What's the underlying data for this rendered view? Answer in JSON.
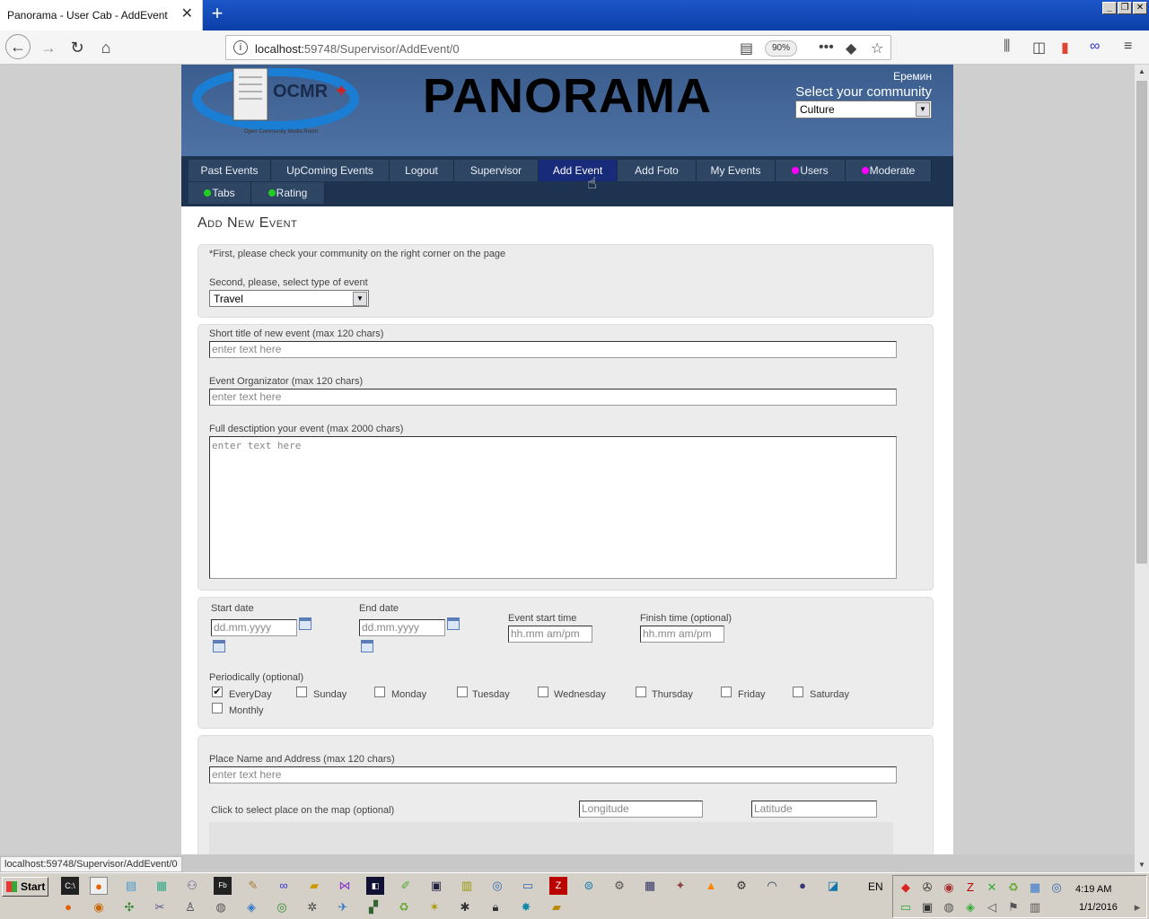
{
  "browser": {
    "tab_title": "Panorama - User Cab - AddEvent",
    "close_tab": "✕",
    "new_tab": "+",
    "url_host": "localhost:",
    "url_path": "59748/Supervisor/AddEvent/0",
    "zoom": "90%",
    "status_url": "localhost:59748/Supervisor/AddEvent/0"
  },
  "header": {
    "logo_text": "OCMR",
    "logo_sub": "Open Community Media Room",
    "brand": "PANORAMA",
    "user": "Еремин",
    "community_label": "Select your community",
    "community_value": "Culture"
  },
  "menu": {
    "past_events": "Past Events",
    "upcoming_events": "UpComing Events",
    "logout": "Logout",
    "supervisor": "Supervisor",
    "add_event": "Add Event",
    "add_foto": "Add Foto",
    "my_events": "My Events",
    "users": "Users",
    "moderate": "Moderate",
    "tabs": "Tabs",
    "rating": "Rating",
    "colors": {
      "magenta": "#ff00ff",
      "green": "#22cc22",
      "active": "#182a7a"
    }
  },
  "form": {
    "page_title": "Add New Event",
    "note_first": "*First, please check your community on the right corner on the page",
    "type_label": "Second, please, select type of event",
    "type_value": "Travel",
    "title_label": "Short title of new event (max 120 chars)",
    "title_placeholder": "enter text here",
    "organizer_label": "Event Organizator (max 120 chars)",
    "organizer_placeholder": "enter text here",
    "description_label": "Full desctiption your event (max 2000 chars)",
    "description_placeholder": "enter text here",
    "start_date_label": "Start date",
    "start_date_placeholder": "dd.mm.yyyy",
    "end_date_label": "End date",
    "end_date_placeholder": "dd.mm.yyyy",
    "start_time_label": "Event start time",
    "start_time_placeholder": "hh.mm am/pm",
    "finish_time_label": "Finish time (optional)",
    "finish_time_placeholder": "hh.mm am/pm",
    "periodically_label": "Periodically (optional)",
    "days": {
      "everyday": "EveryDay",
      "sunday": "Sunday",
      "monday": "Monday",
      "tuesday": "Tuesday",
      "wednesday": "Wednesday",
      "thursday": "Thursday",
      "friday": "Friday",
      "saturday": "Saturday",
      "monthly": "Monthly"
    },
    "everyday_checked": true,
    "place_label": "Place Name and Address (max 120 chars)",
    "place_placeholder": "enter text here",
    "map_label": "Click to select place on the map (optional)",
    "longitude_placeholder": "Longitude",
    "latitude_placeholder": "Latitude"
  },
  "taskbar": {
    "start": "Start",
    "lang": "EN",
    "time": "4:19 AM",
    "date": "1/1/2016"
  }
}
